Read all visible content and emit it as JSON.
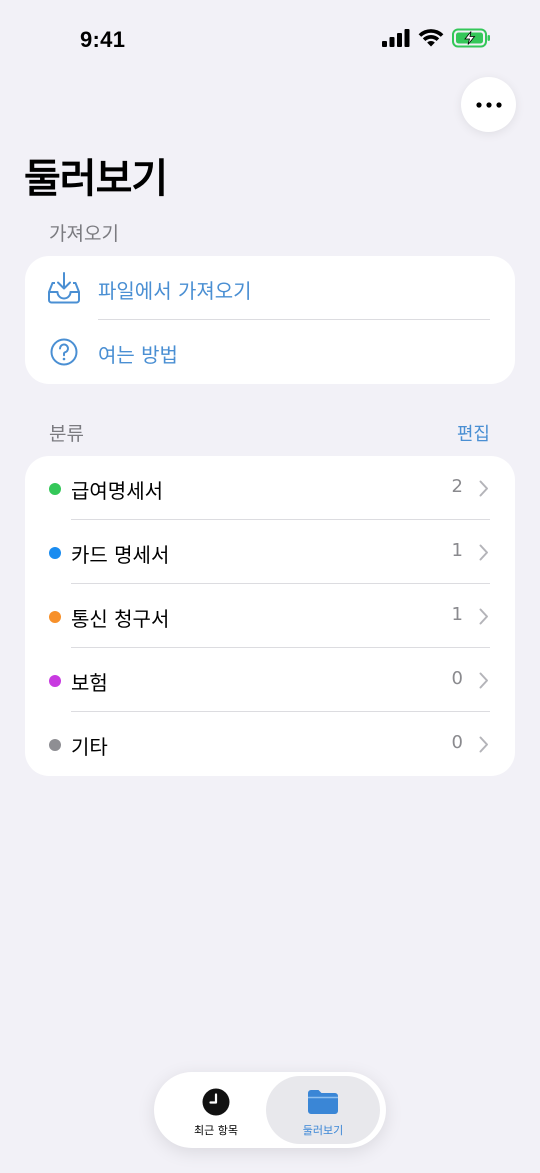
{
  "status_bar": {
    "time": "9:41",
    "icons": [
      "signal-icon",
      "wifi-icon",
      "battery-charging-icon"
    ],
    "battery_color": "#34c759"
  },
  "header": {
    "more_button_icon": "ellipsis-icon",
    "title": "둘러보기"
  },
  "import_section": {
    "header": "가져오기",
    "items": [
      {
        "label": "파일에서 가져오기",
        "icon": "tray-download-icon"
      },
      {
        "label": "여는 방법",
        "icon": "question-circle-icon"
      }
    ],
    "accent_color": "#4a8fd3"
  },
  "categories_section": {
    "header": "분류",
    "edit_label": "편집",
    "items": [
      {
        "label": "급여명세서",
        "count": "2",
        "color": "#34c759"
      },
      {
        "label": "카드 명세서",
        "count": "1",
        "color": "#1a8cf0"
      },
      {
        "label": "통신 청구서",
        "count": "1",
        "color": "#f7902a"
      },
      {
        "label": "보험",
        "count": "0",
        "color": "#c83ae0"
      },
      {
        "label": "기타",
        "count": "0",
        "color": "#8e8e93"
      }
    ]
  },
  "tab_bar": {
    "tabs": [
      {
        "label": "최근 항목",
        "icon": "clock-icon",
        "selected": false
      },
      {
        "label": "둘러보기",
        "icon": "folder-icon",
        "selected": true
      }
    ]
  }
}
